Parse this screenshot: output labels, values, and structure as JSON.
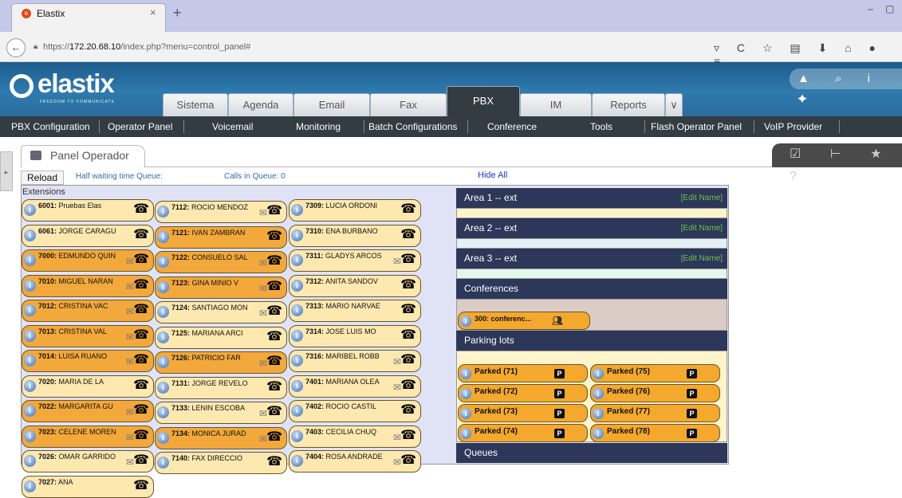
{
  "browser": {
    "tab_title": "Elastix",
    "tab_close": "×",
    "new_tab": "+",
    "url_prefix": "https://",
    "url_host": "172.20.68.10",
    "url_path": "/index.php?menu=control_panel#",
    "window_controls": "– ▢",
    "toolbar_icons": "▿ C ☆ ▤ ⬇ ⌂ ● ≡"
  },
  "header": {
    "logo": "elastix",
    "tagline": "FREEDOM TO COMMUNICATE",
    "menu": [
      "Sistema",
      "Agenda",
      "Email",
      "Fax",
      "PBX",
      "IM",
      "Reports"
    ],
    "more": "∨",
    "active": "PBX",
    "right_icons": "▲ ⌕ i ✦"
  },
  "submenu": [
    "PBX Configuration",
    "Operator Panel",
    "Voicemail",
    "Monitoring",
    "Batch Configurations",
    "Conference",
    "Tools",
    "Flash Operator Panel",
    "VoIP Provider"
  ],
  "page": {
    "title": "Panel Operador",
    "right_icons": "☑ ⊢ ★ ?"
  },
  "toolbar": {
    "reload": "Reload",
    "half_waiting": "Half waiting time Queue:",
    "calls_in_queue": "Calls in Queue: 0",
    "hide_all": "Hide All"
  },
  "extensions_label": "Extensions",
  "extensions": [
    [
      {
        "num": "6001:",
        "name": "Pruebas Elas",
        "mail": false,
        "busy": false
      },
      {
        "num": "6061:",
        "name": "JORGE CARAGU",
        "mail": false,
        "busy": false
      },
      {
        "num": "7000:",
        "name": "EDMUNDO QUIN",
        "mail": true,
        "busy": true
      },
      {
        "num": "7010:",
        "name": "MIGUEL NARAN",
        "mail": true,
        "busy": true
      },
      {
        "num": "7012:",
        "name": "CRISTINA VAC",
        "mail": true,
        "busy": true
      },
      {
        "num": "7013:",
        "name": "CRISTINA VAL",
        "mail": true,
        "busy": true
      },
      {
        "num": "7014:",
        "name": "LUISA RUANO",
        "mail": true,
        "busy": true
      },
      {
        "num": "7020:",
        "name": "MARIA DE LA",
        "mail": false,
        "busy": false
      },
      {
        "num": "7022:",
        "name": "MARGARITA GU",
        "mail": true,
        "busy": true
      },
      {
        "num": "7023:",
        "name": "CELENE MOREN",
        "mail": true,
        "busy": true
      },
      {
        "num": "7026:",
        "name": "OMAR GARRIDO",
        "mail": true,
        "busy": false
      },
      {
        "num": "7027:",
        "name": "ANA",
        "mail": false,
        "busy": false
      }
    ],
    [
      {
        "num": "7112:",
        "name": "ROCIO MENDOZ",
        "mail": true,
        "busy": false
      },
      {
        "num": "7121:",
        "name": "IVAN ZAMBRAN",
        "mail": false,
        "busy": true
      },
      {
        "num": "7122:",
        "name": "CONSUELO SAL",
        "mail": true,
        "busy": true
      },
      {
        "num": "7123:",
        "name": "GINA MINIO V",
        "mail": true,
        "busy": true
      },
      {
        "num": "7124:",
        "name": "SANTIAGO MON",
        "mail": true,
        "busy": false
      },
      {
        "num": "7125:",
        "name": "MARIANA ARCI",
        "mail": false,
        "busy": false
      },
      {
        "num": "7126:",
        "name": "PATRICIO FAR",
        "mail": true,
        "busy": true
      },
      {
        "num": "7131:",
        "name": "JORGE REVELO",
        "mail": false,
        "busy": false
      },
      {
        "num": "7133:",
        "name": "LENIN ESCOBA",
        "mail": true,
        "busy": false
      },
      {
        "num": "7134:",
        "name": "MONICA JURAD",
        "mail": true,
        "busy": true
      },
      {
        "num": "7140:",
        "name": "FAX DIRECCIO",
        "mail": false,
        "busy": false
      }
    ],
    [
      {
        "num": "7309:",
        "name": "LUCIA ORDONI",
        "mail": false,
        "busy": false
      },
      {
        "num": "7310:",
        "name": "ENA BURBANO",
        "mail": false,
        "busy": false
      },
      {
        "num": "7311:",
        "name": "GLADYS ARCOS",
        "mail": true,
        "busy": false
      },
      {
        "num": "7312:",
        "name": "ANITA SANDOV",
        "mail": false,
        "busy": false
      },
      {
        "num": "7313:",
        "name": "MARIO NARVAE",
        "mail": false,
        "busy": false
      },
      {
        "num": "7314:",
        "name": "JOSE LUIS MO",
        "mail": false,
        "busy": false
      },
      {
        "num": "7316:",
        "name": "MARIBEL ROBB",
        "mail": true,
        "busy": false
      },
      {
        "num": "7401:",
        "name": "MARIANA OLEA",
        "mail": true,
        "busy": false
      },
      {
        "num": "7402:",
        "name": "ROCIO CASTIL",
        "mail": false,
        "busy": false
      },
      {
        "num": "7403:",
        "name": "CECILIA CHUQ",
        "mail": true,
        "busy": false
      },
      {
        "num": "7404:",
        "name": "ROSA ANDRADE",
        "mail": true,
        "busy": false
      }
    ]
  ],
  "areas": [
    {
      "title": "Area 1 -- ext",
      "edit": "[Edit Name]"
    },
    {
      "title": "Area 2 -- ext",
      "edit": "[Edit Name]"
    },
    {
      "title": "Area 3 -- ext",
      "edit": "[Edit Name]"
    }
  ],
  "conferences": {
    "title": "Conferences",
    "room": "300: conferenc..."
  },
  "parking": {
    "title": "Parking lots",
    "lots": [
      "Parked (71)",
      "Parked (75)",
      "Parked (72)",
      "Parked (76)",
      "Parked (73)",
      "Parked (77)",
      "Parked (74)",
      "Parked (78)"
    ]
  },
  "queues": {
    "title": "Queues"
  },
  "colors": {
    "accent": "#2c3759",
    "busy": "#f2a83b",
    "idle": "#fde8b0"
  }
}
